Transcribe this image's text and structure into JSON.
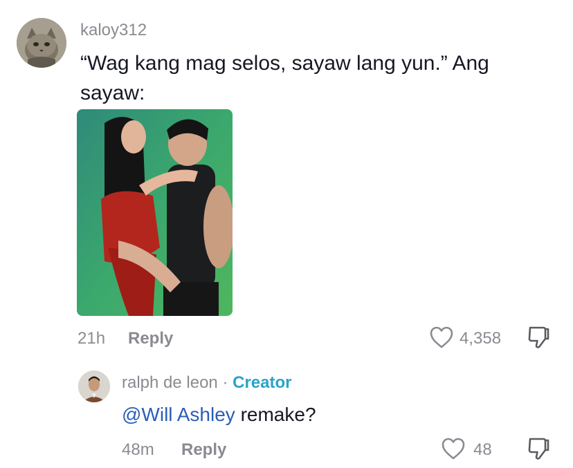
{
  "comment": {
    "username": "kaloy312",
    "text": "“Wag kang mag selos, sayaw lang yun.” Ang sayaw:",
    "time": "21h",
    "reply_label": "Reply",
    "likes": "4,358",
    "avatar": "cat-avatar",
    "photo": "dance-photo"
  },
  "reply": {
    "username": "ralph de leon",
    "separator": "·",
    "badge": "Creator",
    "mention": "@Will Ashley",
    "text": " remake?",
    "time": "48m",
    "reply_label": "Reply",
    "likes": "48",
    "avatar": "man-in-suit-avatar"
  },
  "colors": {
    "secondary_text": "#8a8b91",
    "creator": "#2aa3c8",
    "mention": "#2b5db5"
  },
  "icons": {
    "like": "heart-outline-icon",
    "dislike": "thumbs-down-icon"
  }
}
